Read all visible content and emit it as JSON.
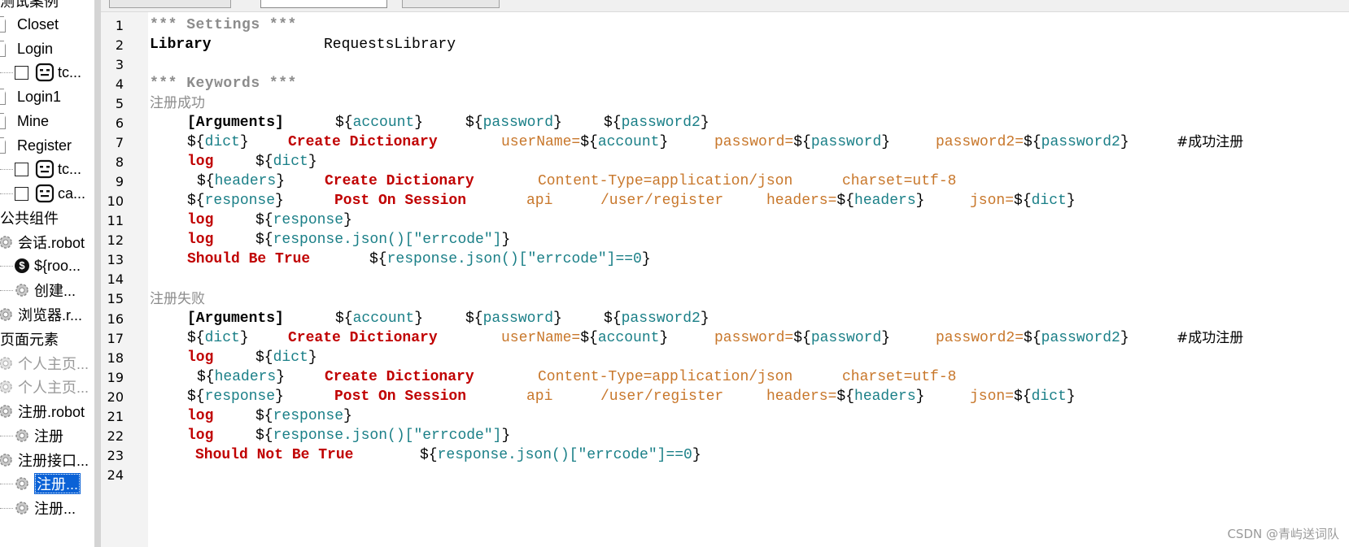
{
  "tree": {
    "top_partial": "测试案例",
    "items": [
      {
        "label": "Closet",
        "kind": "file"
      },
      {
        "label": "Login",
        "kind": "file"
      },
      {
        "label": "tc...",
        "kind": "testcase"
      },
      {
        "label": "Login1",
        "kind": "file"
      },
      {
        "label": "Mine",
        "kind": "file"
      },
      {
        "label": "Register",
        "kind": "file"
      },
      {
        "label": "tc...",
        "kind": "testcase"
      },
      {
        "label": "ca...",
        "kind": "testcase"
      },
      {
        "label": "公共组件",
        "kind": "section"
      },
      {
        "label": "会话.robot",
        "kind": "resource"
      },
      {
        "label": "${roo...",
        "kind": "variable"
      },
      {
        "label": "创建...",
        "kind": "keyword"
      },
      {
        "label": "浏览器.r...",
        "kind": "resource"
      },
      {
        "label": "页面元素",
        "kind": "section"
      },
      {
        "label": "个人主页...",
        "kind": "resource-grey"
      },
      {
        "label": "个人主页...",
        "kind": "resource-grey"
      },
      {
        "label": "注册.robot",
        "kind": "resource"
      },
      {
        "label": "注册",
        "kind": "keyword"
      },
      {
        "label": "注册接口...",
        "kind": "resource"
      },
      {
        "label": "注册...",
        "kind": "keyword-selected"
      },
      {
        "label": "注册...",
        "kind": "keyword"
      }
    ]
  },
  "editor": {
    "line_numbers": [
      "1",
      "2",
      "3",
      "4",
      "5",
      "6",
      "7",
      "8",
      "9",
      "10",
      "11",
      "12",
      "13",
      "14",
      "15",
      "16",
      "17",
      "18",
      "19",
      "20",
      "21",
      "22",
      "23",
      "24"
    ],
    "lines": {
      "l1": "*** Settings ***",
      "l2a": "Library",
      "l2b": "RequestsLibrary",
      "l4": "*** Keywords ***",
      "l5": "注册成功",
      "l6a": "[Arguments]",
      "l6b": "account",
      "l6c": "password",
      "l6d": "password2",
      "l7a": "dict",
      "l7b": "Create Dictionary",
      "l7c": "userName=",
      "l7d": "account",
      "l7e": "password=",
      "l7f": "password",
      "l7g": "password2=",
      "l7h": "password2",
      "l7i": "#成功注册",
      "l8a": "log",
      "l8b": "dict",
      "l9a": "headers",
      "l9b": "Create Dictionary",
      "l9c": "Content-Type=application/json",
      "l9d": "charset=utf-8",
      "l10a": "response",
      "l10b": "Post On Session",
      "l10c": "api",
      "l10d": "/user/register",
      "l10e": "headers=",
      "l10f": "headers",
      "l10g": "json=",
      "l10h": "dict",
      "l11a": "log",
      "l11b": "response",
      "l12a": "log",
      "l12b": "response.json()[\"errcode\"]",
      "l13a": "Should Be True",
      "l13b": "response.json()[\"errcode\"]==0",
      "l15": "注册失败",
      "l16a": "[Arguments]",
      "l16b": "account",
      "l16c": "password",
      "l16d": "password2",
      "l17a": "dict",
      "l17b": "Create Dictionary",
      "l17c": "userName=",
      "l17d": "account",
      "l17e": "password=",
      "l17f": "password",
      "l17g": "password2=",
      "l17h": "password2",
      "l17i": "#成功注册",
      "l18a": "log",
      "l18b": "dict",
      "l19a": "headers",
      "l19b": "Create Dictionary",
      "l19c": "Content-Type=application/json",
      "l19d": "charset=utf-8",
      "l20a": "response",
      "l20b": "Post On Session",
      "l20c": "api",
      "l20d": "/user/register",
      "l20e": "headers=",
      "l20f": "headers",
      "l20g": "json=",
      "l20h": "dict",
      "l21a": "log",
      "l21b": "response",
      "l22a": "log",
      "l22b": "response.json()[\"errcode\"]",
      "l23a": "Should Not Be True",
      "l23b": "response.json()[\"errcode\"]==0"
    }
  },
  "watermark": "CSDN @青屿送词队",
  "colors": {
    "keyword": "#c00000",
    "variable_name": "#1a7f87",
    "argument": "#c8772b",
    "comment": "#8c8c8c",
    "selection": "#0b62d6"
  }
}
